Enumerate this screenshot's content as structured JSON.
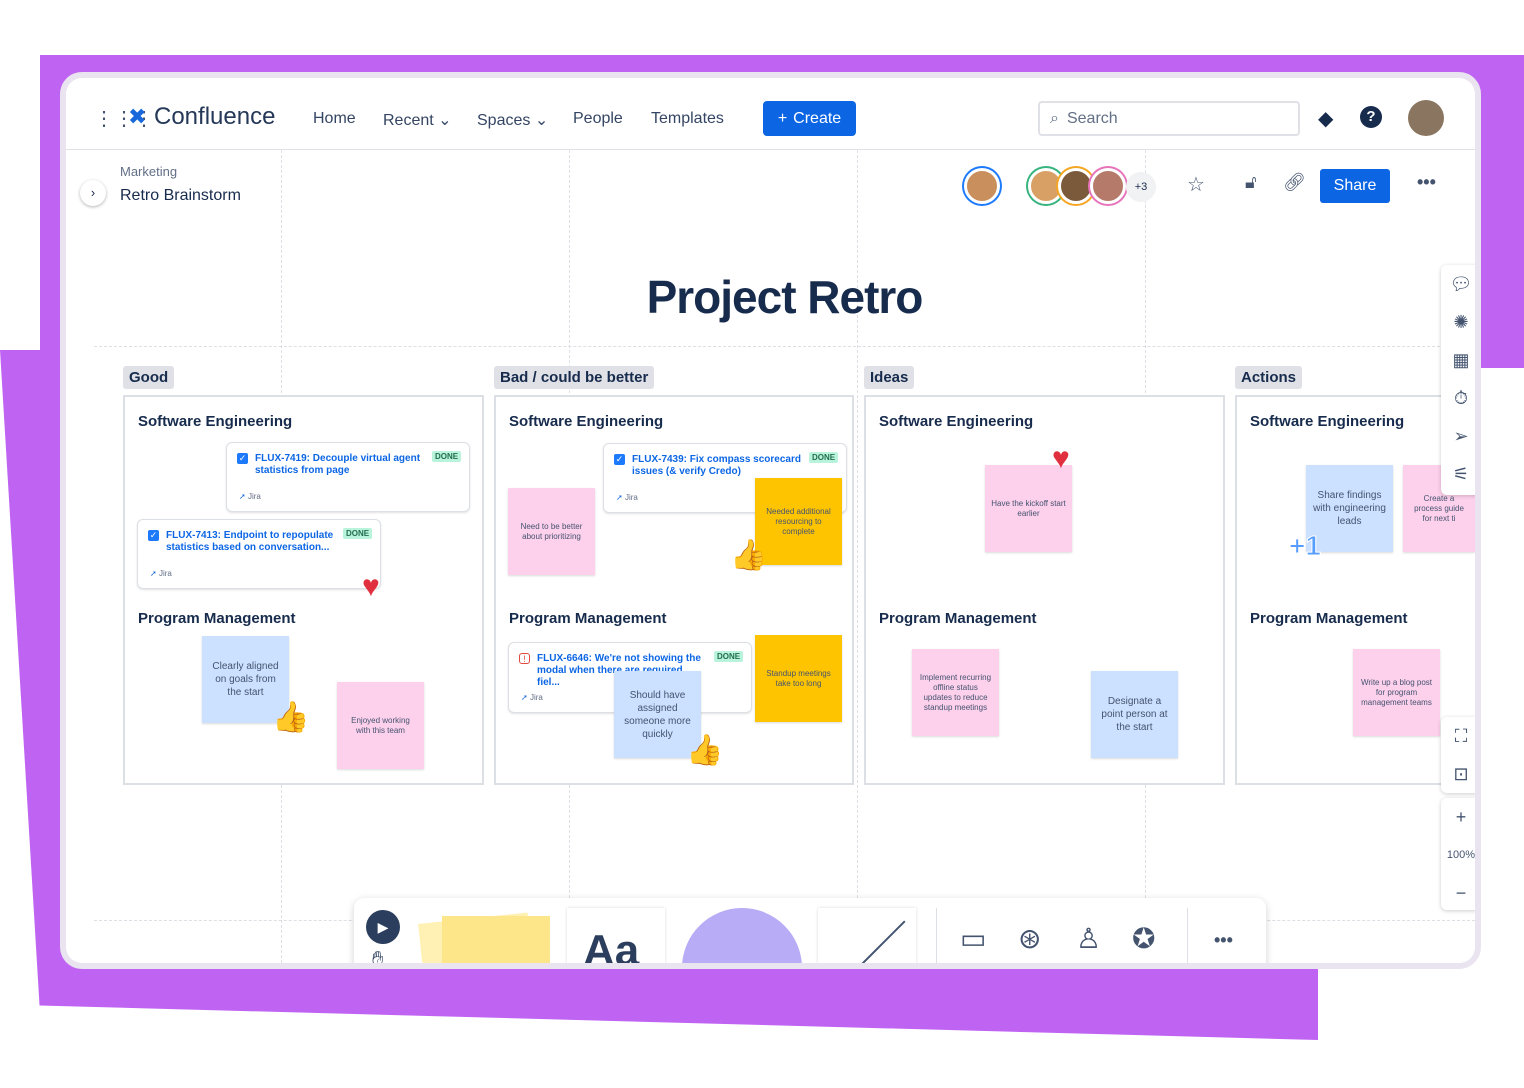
{
  "nav": {
    "app_name": "Confluence",
    "links": [
      "Home",
      "Recent",
      "Spaces",
      "People",
      "Templates"
    ],
    "create_label": "Create",
    "search_placeholder": "Search"
  },
  "breadcrumb": {
    "space": "Marketing",
    "page": "Retro Brainstorm"
  },
  "header": {
    "extra_collaborators": "+3",
    "share_label": "Share"
  },
  "whiteboard": {
    "title": "Project Retro",
    "columns": [
      {
        "label": "Good",
        "sections": [
          "Software Engineering",
          "Program Management"
        ]
      },
      {
        "label": "Bad / could be better",
        "sections": [
          "Software Engineering",
          "Program Management"
        ]
      },
      {
        "label": "Ideas",
        "sections": [
          "Software Engineering",
          "Program Management"
        ]
      },
      {
        "label": "Actions",
        "sections": [
          "Software Engineering",
          "Program Management"
        ]
      }
    ],
    "jira_cards": [
      {
        "title": "FLUX-7419: Decouple virtual agent statistics from page",
        "status": "DONE",
        "source": "Jira"
      },
      {
        "title": "FLUX-7413: Endpoint to repopulate statistics based on conversation...",
        "status": "DONE",
        "source": "Jira"
      },
      {
        "title": "FLUX-7439: Fix compass scorecard issues (& verify Credo)",
        "status": "DONE",
        "source": "Jira"
      },
      {
        "title": "FLUX-6646: We're not showing the modal when there are required fiel...",
        "status": "DONE",
        "source": "Jira"
      }
    ],
    "stickies": [
      {
        "text": "Clearly aligned on goals from the start",
        "color": "#cce0ff"
      },
      {
        "text": "Enjoyed working with this team",
        "color": "#fdd0ec"
      },
      {
        "text": "Need to be better about prioritizing",
        "color": "#fdd0ec"
      },
      {
        "text": "Needed additional resourcing to complete",
        "color": "#ffc400"
      },
      {
        "text": "Standup meetings take too long",
        "color": "#ffc400"
      },
      {
        "text": "Should have assigned someone more quickly",
        "color": "#cce0ff"
      },
      {
        "text": "Have the kickoff start earlier",
        "color": "#fdd0ec"
      },
      {
        "text": "Implement recurring offline status updates to reduce standup meetings",
        "color": "#fdd0ec"
      },
      {
        "text": "Designate a point person at the start",
        "color": "#cce0ff"
      },
      {
        "text": "Share findings with engineering leads",
        "color": "#cce0ff"
      },
      {
        "text": "Create a process guide for next ti",
        "color": "#fdd0ec"
      },
      {
        "text": "Write up a blog post for program management teams",
        "color": "#fdd0ec"
      }
    ],
    "plus_one": "+1"
  },
  "zoom": {
    "level": "100%"
  },
  "toolbar": {
    "text_tool": "Aa"
  },
  "colors": {
    "brand": "#0c66e4",
    "frame_purple": "#bf63f3"
  }
}
